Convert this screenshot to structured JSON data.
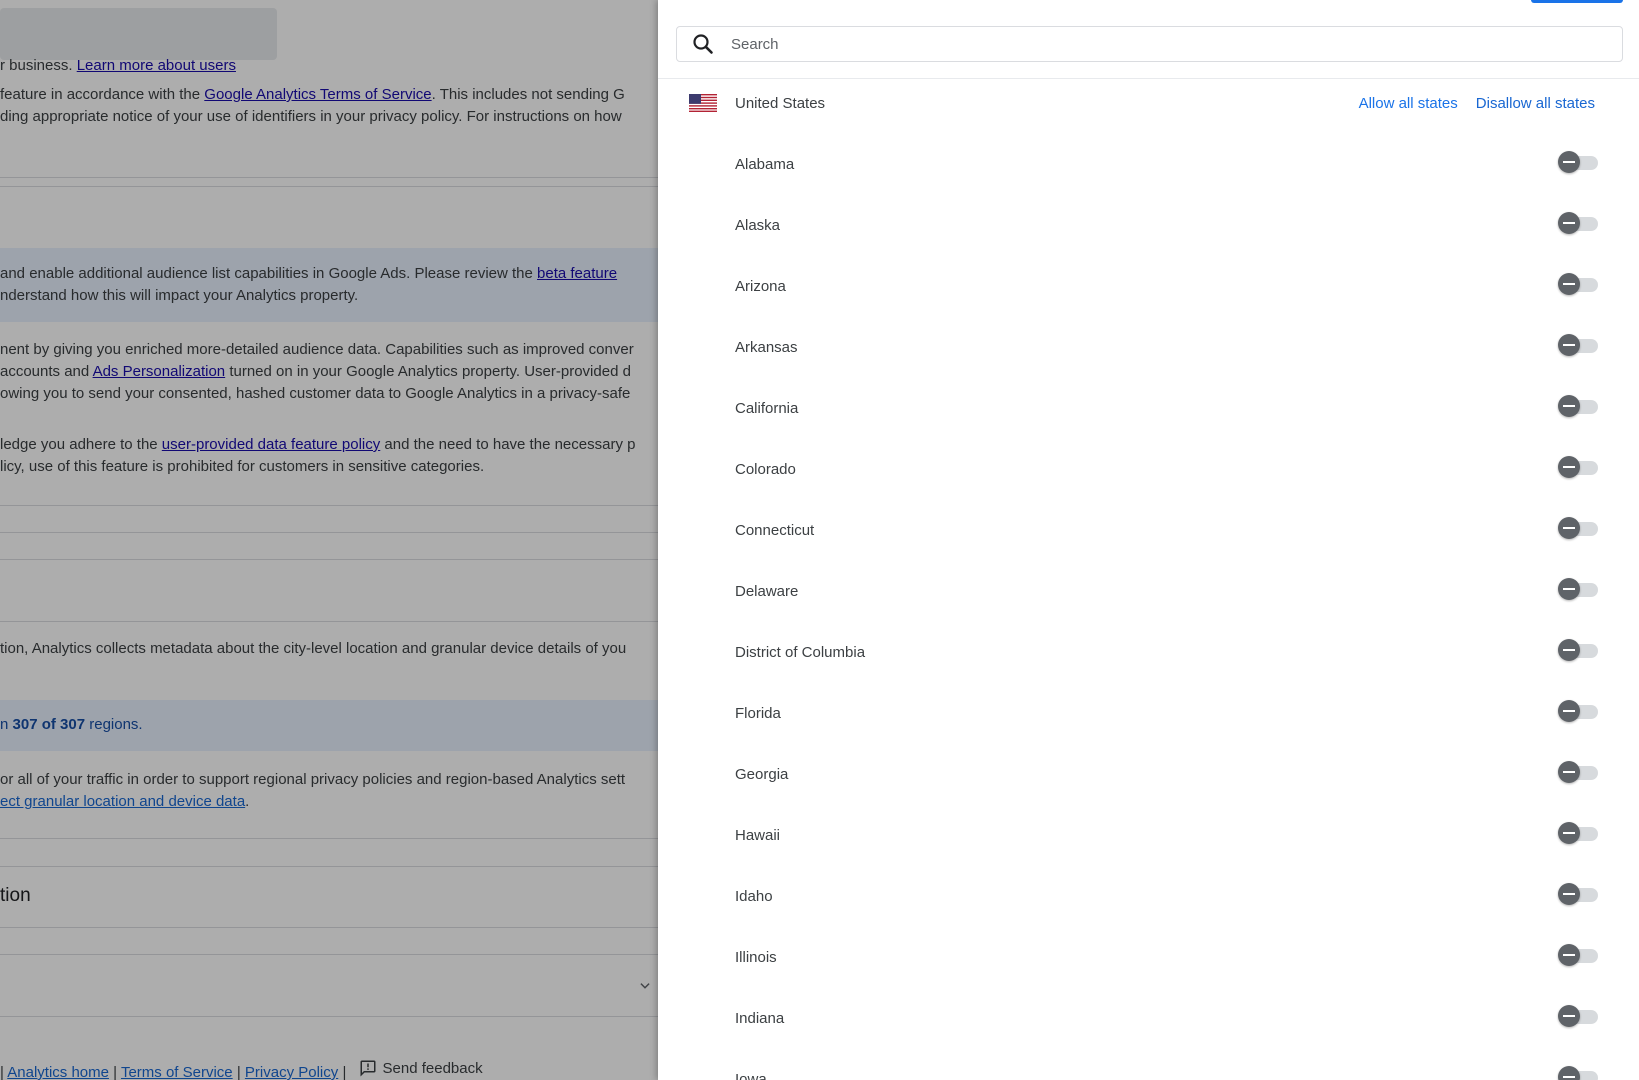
{
  "background": {
    "top_line": {
      "text": "r business. ",
      "link": "Learn more about users"
    },
    "para1": {
      "l1_pre": "feature in accordance with the ",
      "l1_link": "Google Analytics Terms of Service",
      "l1_post": ". This includes not sending G",
      "l2": "ding appropriate notice of your use of identifiers in your privacy policy. For instructions on how"
    },
    "beta": {
      "l1_pre": "and enable additional audience list capabilities in Google Ads. Please review the ",
      "l1_link": "beta feature",
      "l2": "nderstand how this will impact your Analytics property."
    },
    "para2": {
      "l1": "nent by giving you enriched more-detailed audience data. Capabilities such as improved conver",
      "l2_pre": "accounts and ",
      "l2_link": "Ads Personalization",
      "l2_post": " turned on in your Google Analytics property. User-provided d",
      "l3": "owing you to send your consented, hashed customer data to Google Analytics in a privacy-safe"
    },
    "para3": {
      "l1_pre": "ledge you adhere to the ",
      "l1_link": "user-provided data feature policy",
      "l1_post": " and the need to have the necessary p",
      "l2": "licy, use of this feature is prohibited for customers in sensitive categories."
    },
    "para4": "tion, Analytics collects metadata about the city-level location and granular device details of you",
    "regions": {
      "prefix": "n ",
      "count": "307 of 307",
      "suffix": " regions."
    },
    "para5": {
      "l1": "or all of your traffic in order to support regional privacy policies and region-based Analytics sett",
      "l2_link": "ect granular location and device data",
      "l2_post": "."
    },
    "section_heading": "tion",
    "footer": {
      "sep": "|",
      "links": [
        "Analytics home",
        "Terms of Service",
        "Privacy Policy"
      ],
      "feedback": "Send feedback"
    }
  },
  "drawer": {
    "search": {
      "placeholder": "Search",
      "value": ""
    },
    "country": {
      "name": "United States",
      "allow_all": "Allow all states",
      "disallow_all": "Disallow all states"
    },
    "states": [
      {
        "name": "Alabama",
        "state": "indeterminate"
      },
      {
        "name": "Alaska",
        "state": "indeterminate"
      },
      {
        "name": "Arizona",
        "state": "indeterminate"
      },
      {
        "name": "Arkansas",
        "state": "indeterminate"
      },
      {
        "name": "California",
        "state": "indeterminate"
      },
      {
        "name": "Colorado",
        "state": "indeterminate"
      },
      {
        "name": "Connecticut",
        "state": "indeterminate"
      },
      {
        "name": "Delaware",
        "state": "indeterminate"
      },
      {
        "name": "District of Columbia",
        "state": "indeterminate"
      },
      {
        "name": "Florida",
        "state": "indeterminate"
      },
      {
        "name": "Georgia",
        "state": "indeterminate"
      },
      {
        "name": "Hawaii",
        "state": "indeterminate"
      },
      {
        "name": "Idaho",
        "state": "indeterminate"
      },
      {
        "name": "Illinois",
        "state": "indeterminate"
      },
      {
        "name": "Indiana",
        "state": "indeterminate"
      },
      {
        "name": "Iowa",
        "state": "indeterminate"
      }
    ]
  },
  "colors": {
    "accent": "#1a73e8",
    "link": "#1967d2",
    "scrim": "rgba(0,0,0,0.32)",
    "toggle_thumb": "#5f6368"
  }
}
